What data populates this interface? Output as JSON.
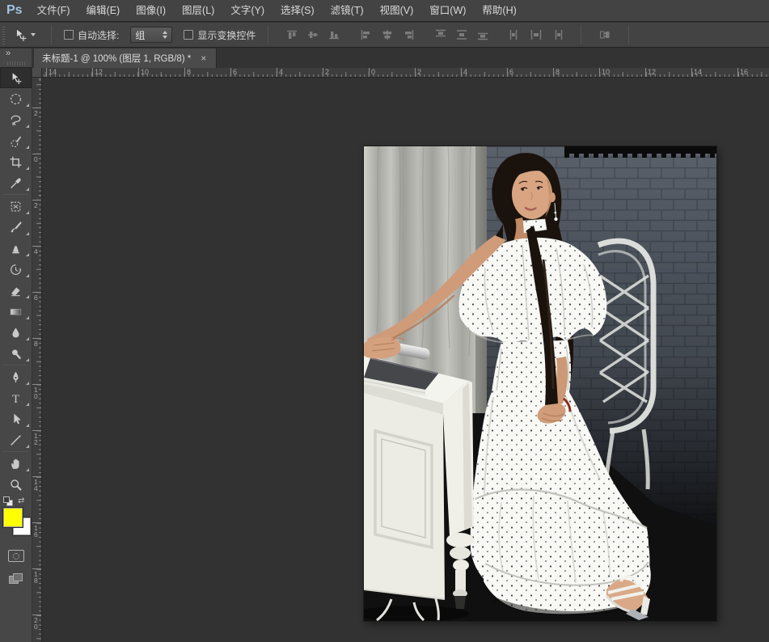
{
  "app": {
    "logo_text": "Ps"
  },
  "menu_bar": {
    "items": [
      {
        "name": "file",
        "label": "文件(F)"
      },
      {
        "name": "edit",
        "label": "编辑(E)"
      },
      {
        "name": "image",
        "label": "图像(I)"
      },
      {
        "name": "layer",
        "label": "图层(L)"
      },
      {
        "name": "type",
        "label": "文字(Y)"
      },
      {
        "name": "select",
        "label": "选择(S)"
      },
      {
        "name": "filter",
        "label": "滤镜(T)"
      },
      {
        "name": "view",
        "label": "视图(V)"
      },
      {
        "name": "window",
        "label": "窗口(W)"
      },
      {
        "name": "help",
        "label": "帮助(H)"
      }
    ]
  },
  "options_bar": {
    "active_tool_icon": "move-tool",
    "auto_select": {
      "label": "自动选择:",
      "checked": false
    },
    "auto_select_target": {
      "value": "组"
    },
    "show_transform": {
      "label": "显示变换控件",
      "checked": false
    },
    "align_buttons": [
      {
        "name": "align-top-edges",
        "enabled": false
      },
      {
        "name": "align-vertical-centers",
        "enabled": false
      },
      {
        "name": "align-bottom-edges",
        "enabled": false
      },
      {
        "name": "align-left-edges",
        "enabled": false
      },
      {
        "name": "align-horizontal-centers",
        "enabled": false
      },
      {
        "name": "align-right-edges",
        "enabled": false
      },
      {
        "name": "distribute-top-edges",
        "enabled": false
      },
      {
        "name": "distribute-vertical-centers",
        "enabled": false
      },
      {
        "name": "distribute-bottom-edges",
        "enabled": false
      },
      {
        "name": "distribute-left-edges",
        "enabled": false
      },
      {
        "name": "distribute-horizontal-centers",
        "enabled": false
      },
      {
        "name": "distribute-right-edges",
        "enabled": false
      },
      {
        "name": "auto-align-layers",
        "enabled": false
      }
    ]
  },
  "document_tab": {
    "title": "未标题-1 @ 100% (图层 1, RGB/8) *",
    "close": "×",
    "document_name": "未标题-1",
    "zoom": "100%",
    "active_layer": "图层 1",
    "color_mode": "RGB/8",
    "unsaved_changes": true
  },
  "toolbar": {
    "collapse_glyph": "»",
    "tools": [
      {
        "name": "move-tool",
        "selected": true,
        "flyout": false
      },
      {
        "name": "elliptical-marquee-tool",
        "selected": false,
        "flyout": true
      },
      {
        "name": "lasso-tool",
        "selected": false,
        "flyout": true
      },
      {
        "name": "quick-selection-tool",
        "selected": false,
        "flyout": true
      },
      {
        "name": "crop-tool",
        "selected": false,
        "flyout": true
      },
      {
        "name": "eyedropper-tool",
        "selected": false,
        "flyout": true
      },
      {
        "name": "spot-healing-brush-tool",
        "selected": false,
        "flyout": true
      },
      {
        "name": "brush-tool",
        "selected": false,
        "flyout": true
      },
      {
        "name": "clone-stamp-tool",
        "selected": false,
        "flyout": true
      },
      {
        "name": "history-brush-tool",
        "selected": false,
        "flyout": true
      },
      {
        "name": "eraser-tool",
        "selected": false,
        "flyout": true
      },
      {
        "name": "gradient-tool",
        "selected": false,
        "flyout": true
      },
      {
        "name": "blur-tool",
        "selected": false,
        "flyout": true
      },
      {
        "name": "dodge-tool",
        "selected": false,
        "flyout": true
      },
      {
        "name": "pen-tool",
        "selected": false,
        "flyout": true
      },
      {
        "name": "horizontal-type-tool",
        "selected": false,
        "flyout": true
      },
      {
        "name": "path-selection-tool",
        "selected": false,
        "flyout": true
      },
      {
        "name": "line-tool",
        "selected": false,
        "flyout": true
      },
      {
        "name": "hand-tool",
        "selected": false,
        "flyout": true
      },
      {
        "name": "zoom-tool",
        "selected": false,
        "flyout": false
      }
    ],
    "foreground_color": "#ffff00",
    "background_color": "#ffffff"
  },
  "rulers": {
    "unit": "cm",
    "horizontal_labels": [
      "14",
      "12",
      "10",
      "8",
      "6",
      "4",
      "2",
      "0",
      "2",
      "4",
      "6",
      "8",
      "10",
      "12",
      "14",
      "16"
    ],
    "vertical_labels": [
      "2",
      "0",
      "2",
      "4",
      "6",
      "8",
      "10",
      "12",
      "14",
      "16",
      "18",
      "20"
    ]
  }
}
